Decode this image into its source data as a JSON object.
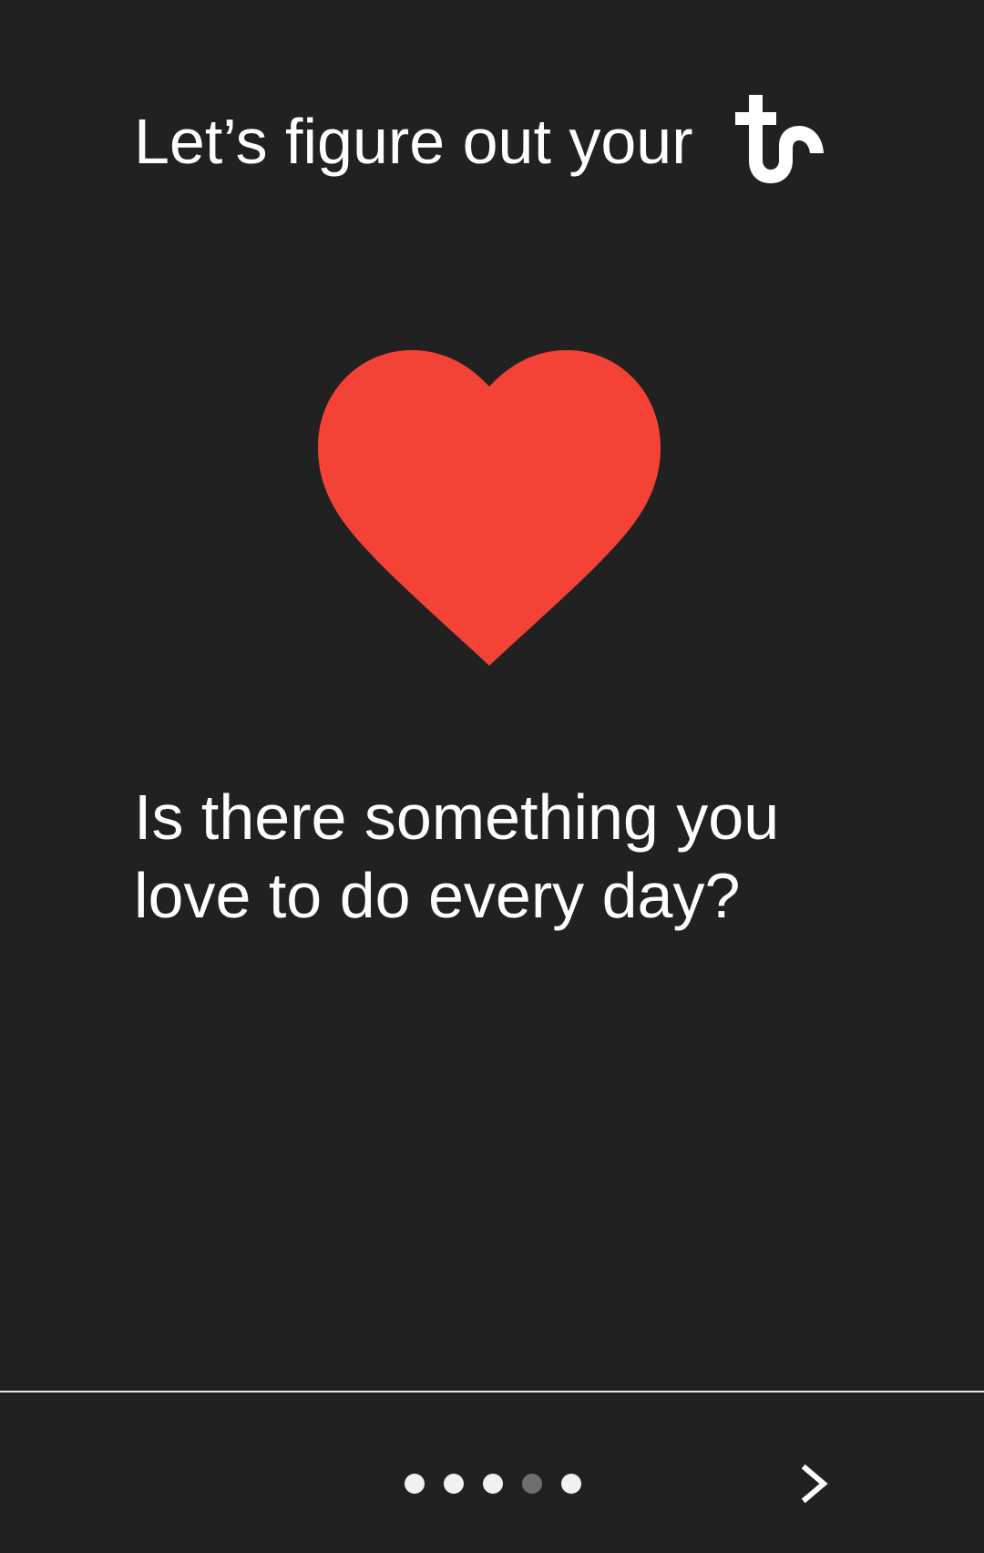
{
  "header": {
    "title": "Let’s figure out your",
    "logo_icon": "tc-logo-icon"
  },
  "hero": {
    "icon": "heart-icon",
    "color": "#f44336"
  },
  "question": {
    "text": "Is there something you love to do every day?"
  },
  "pager": {
    "dots": 5,
    "active_index": 3
  },
  "navigation": {
    "next_icon": "chevron-right-icon"
  },
  "colors": {
    "background": "#212121",
    "text": "#ffffff",
    "accent": "#f44336"
  }
}
